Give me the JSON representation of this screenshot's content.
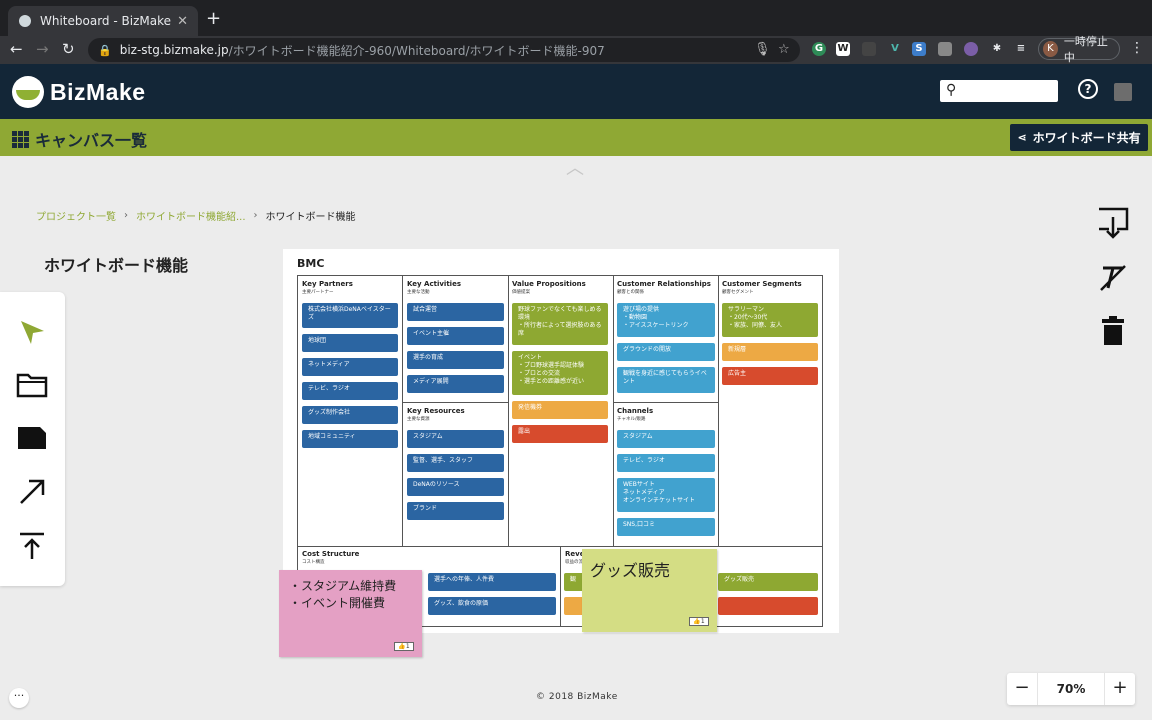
{
  "browser": {
    "tab_title": "Whiteboard - BizMake",
    "url_host": "biz-stg.bizmake.jp",
    "url_path": "/ホワイトボード機能紹介-960/Whiteboard/ホワイトボード機能-907",
    "profile_label": "一時停止中",
    "profile_initial": "K"
  },
  "app": {
    "logo_text": "BizMake",
    "canvas_list_label": "キャンバス一覧",
    "share_label": "ホワイトボード共有",
    "help_label": "?"
  },
  "breadcrumb": {
    "items": [
      "プロジェクト一覧",
      "ホワイトボード機能紹...",
      "ホワイトボード機能"
    ],
    "separator": "›"
  },
  "page_title": "ホワイトボード機能",
  "board": {
    "title": "BMC",
    "cells": {
      "key_partners": {
        "title": "Key Partners",
        "sub": "主要パートナー"
      },
      "key_activities": {
        "title": "Key Activities",
        "sub": "主要な活動"
      },
      "key_resources": {
        "title": "Key Resources",
        "sub": "主要な資源"
      },
      "value_propositions": {
        "title": "Value Propositions",
        "sub": "価値提案"
      },
      "customer_relationships": {
        "title": "Customer Relationships",
        "sub": "顧客との関係"
      },
      "channels": {
        "title": "Channels",
        "sub": "チャネル/販路"
      },
      "customer_segments": {
        "title": "Customer Segments",
        "sub": "顧客セグメント"
      },
      "cost_structure": {
        "title": "Cost Structure",
        "sub": "コスト構造"
      },
      "revenue_streams": {
        "title": "Reve",
        "sub": "収益の流"
      }
    },
    "notes": {
      "kp": [
        "株式会社横浜DeNAベイスターズ",
        "地球団",
        "ネットメディア",
        "テレビ、ラジオ",
        "グッズ制作会社",
        "地域コミュニティ"
      ],
      "ka": [
        "試合運営",
        "イベント主催",
        "選手の育成",
        "メディア展開"
      ],
      "kr": [
        "スタジアム",
        "監督、選手、スタッフ",
        "DeNAのリソース",
        "ブランド"
      ],
      "vp": [
        "野球ファンでなくても楽しめる環境\n・所行者によって選択肢のある席",
        "イベント\n・プロ野球選手認証体験\n・プロとの交流\n・選手との距離感が近い",
        "発信機券",
        "露出"
      ],
      "cr": [
        "遊び場の提供\n・動物園\n・アイススケートリンク",
        "グラウンドの開放",
        "観戦を身近に感じてもらうイベント"
      ],
      "ch": [
        "スタジアム",
        "テレビ、ラジオ",
        "WEBサイト\nネットメディア\nオンラインチケットサイト",
        "SNS,口コミ"
      ],
      "cs": [
        "サラリーマン\n・20代〜30代\n・家族、同僚、友人",
        "新規層",
        "広告主"
      ],
      "cost": [
        "選手への年俸、人件費",
        "グッズ、飲食の原価"
      ],
      "rev": [
        "観",
        "グッズ販売"
      ]
    }
  },
  "stickies": {
    "pink": [
      "・スタジアム維持費",
      "・イベント開催費"
    ],
    "yellow": "グッズ販売",
    "like_count": "1"
  },
  "footer": {
    "copyright": "© 2018 BizMake",
    "zoom_value": "70%",
    "zoom_minus": "−",
    "zoom_plus": "+",
    "more": "···"
  },
  "colors": {
    "header_bg": "#132637",
    "brand_green": "#8fa834",
    "note_blue": "#2b65a2",
    "note_light_blue": "#41a2cf",
    "note_green": "#8ea832",
    "note_orange": "#eda944",
    "note_red": "#d74b2d",
    "sticky_pink": "#e4a0c4",
    "sticky_yellow": "#d4dd84"
  },
  "icons": {
    "palette": [
      "select-arrow-icon",
      "folder-icon",
      "file-icon",
      "connector-arrow-icon",
      "upload-icon"
    ],
    "right": [
      "download-icon",
      "clear-format-icon",
      "trash-icon"
    ]
  }
}
